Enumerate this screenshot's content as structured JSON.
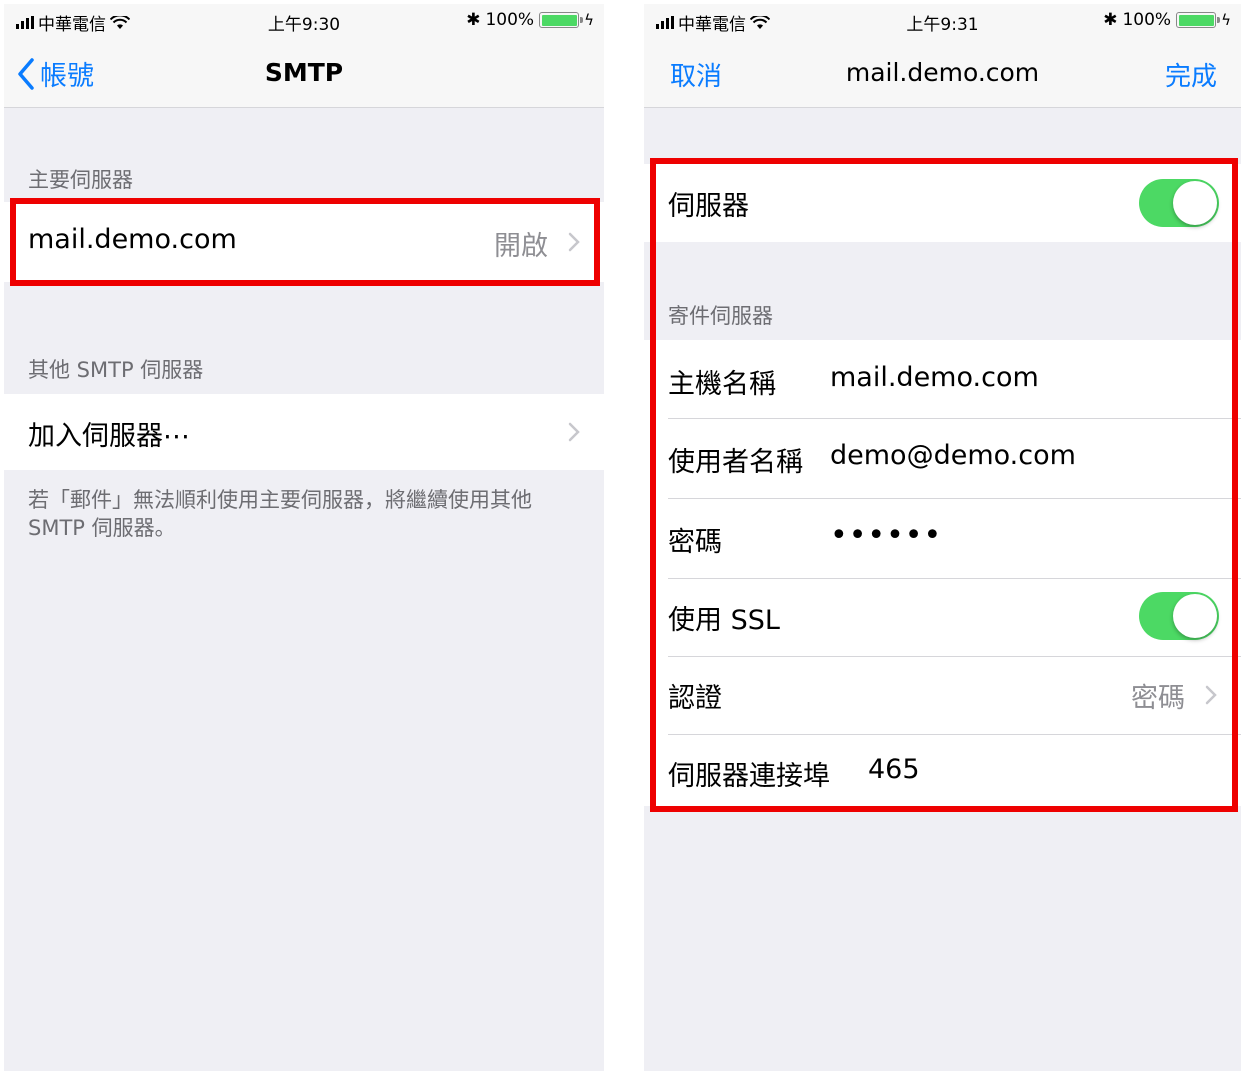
{
  "left": {
    "status": {
      "carrier": "中華電信",
      "time": "上午9:30",
      "battery": "100%"
    },
    "nav": {
      "back_label": "帳號",
      "title": "SMTP"
    },
    "primary_header": "主要伺服器",
    "primary_server": {
      "host": "mail.demo.com",
      "status": "開啟"
    },
    "other_header": "其他 SMTP 伺服器",
    "add_server_label": "加入伺服器⋯",
    "footer": "若「郵件」無法順利使用主要伺服器，將繼續使用其他 SMTP 伺服器。"
  },
  "right": {
    "status": {
      "carrier": "中華電信",
      "time": "上午9:31",
      "battery": "100%"
    },
    "nav": {
      "cancel_label": "取消",
      "title": "mail.demo.com",
      "done_label": "完成"
    },
    "server_toggle": {
      "label": "伺服器",
      "on": true
    },
    "outgoing_header": "寄件伺服器",
    "fields": {
      "hostname": {
        "label": "主機名稱",
        "value": "mail.demo.com"
      },
      "username": {
        "label": "使用者名稱",
        "value": "demo@demo.com"
      },
      "password": {
        "label": "密碼",
        "value": "••••••"
      },
      "ssl": {
        "label": "使用 SSL",
        "on": true
      },
      "auth": {
        "label": "認證",
        "value": "密碼"
      },
      "port": {
        "label": "伺服器連接埠",
        "value": "465"
      }
    }
  },
  "colors": {
    "accent": "#0a7cff",
    "highlight": "#ee0000",
    "toggle_on": "#4cd964"
  }
}
